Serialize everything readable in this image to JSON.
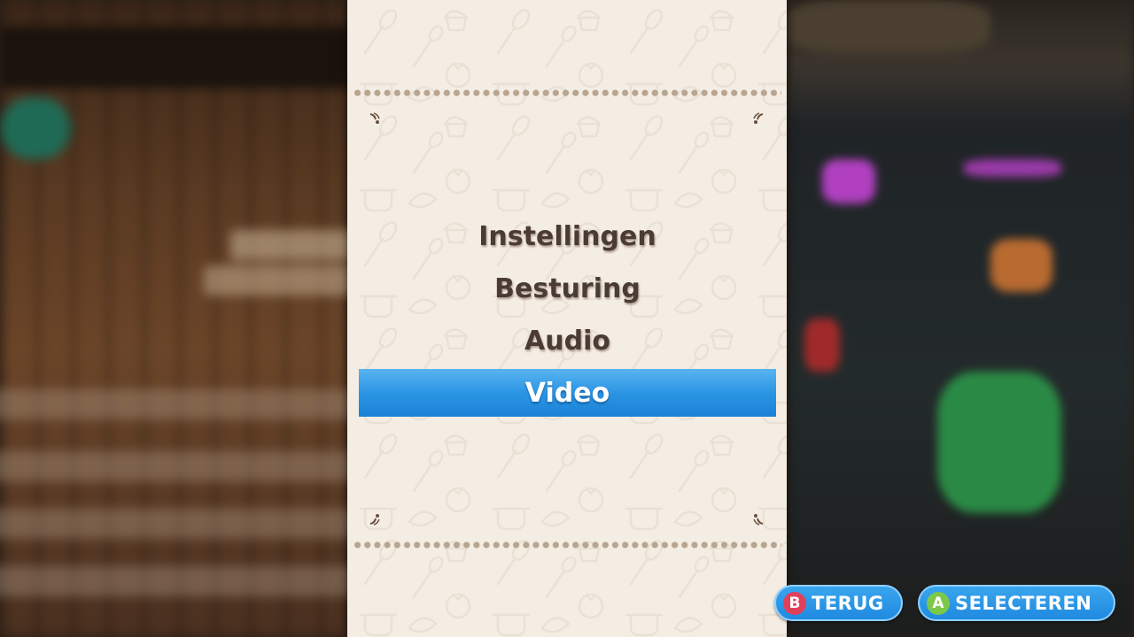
{
  "menu": {
    "items": [
      {
        "label": "Instellingen",
        "selected": false
      },
      {
        "label": "Besturing",
        "selected": false
      },
      {
        "label": "Audio",
        "selected": false
      },
      {
        "label": "Video",
        "selected": true
      }
    ]
  },
  "hints": {
    "back": {
      "button": "B",
      "label": "TERUG",
      "button_color": "#e0405a"
    },
    "select": {
      "button": "A",
      "label": "SELECTEREN",
      "button_color": "#7cc94a"
    }
  },
  "colors": {
    "panel": "#f4ede3",
    "selected_bar": "#2b95e4",
    "menu_text": "#4a3b35",
    "hint_bg": "#2a97e6"
  },
  "icons": [
    "cooking-doodle-pattern-icon",
    "corner-flourish-icon"
  ]
}
